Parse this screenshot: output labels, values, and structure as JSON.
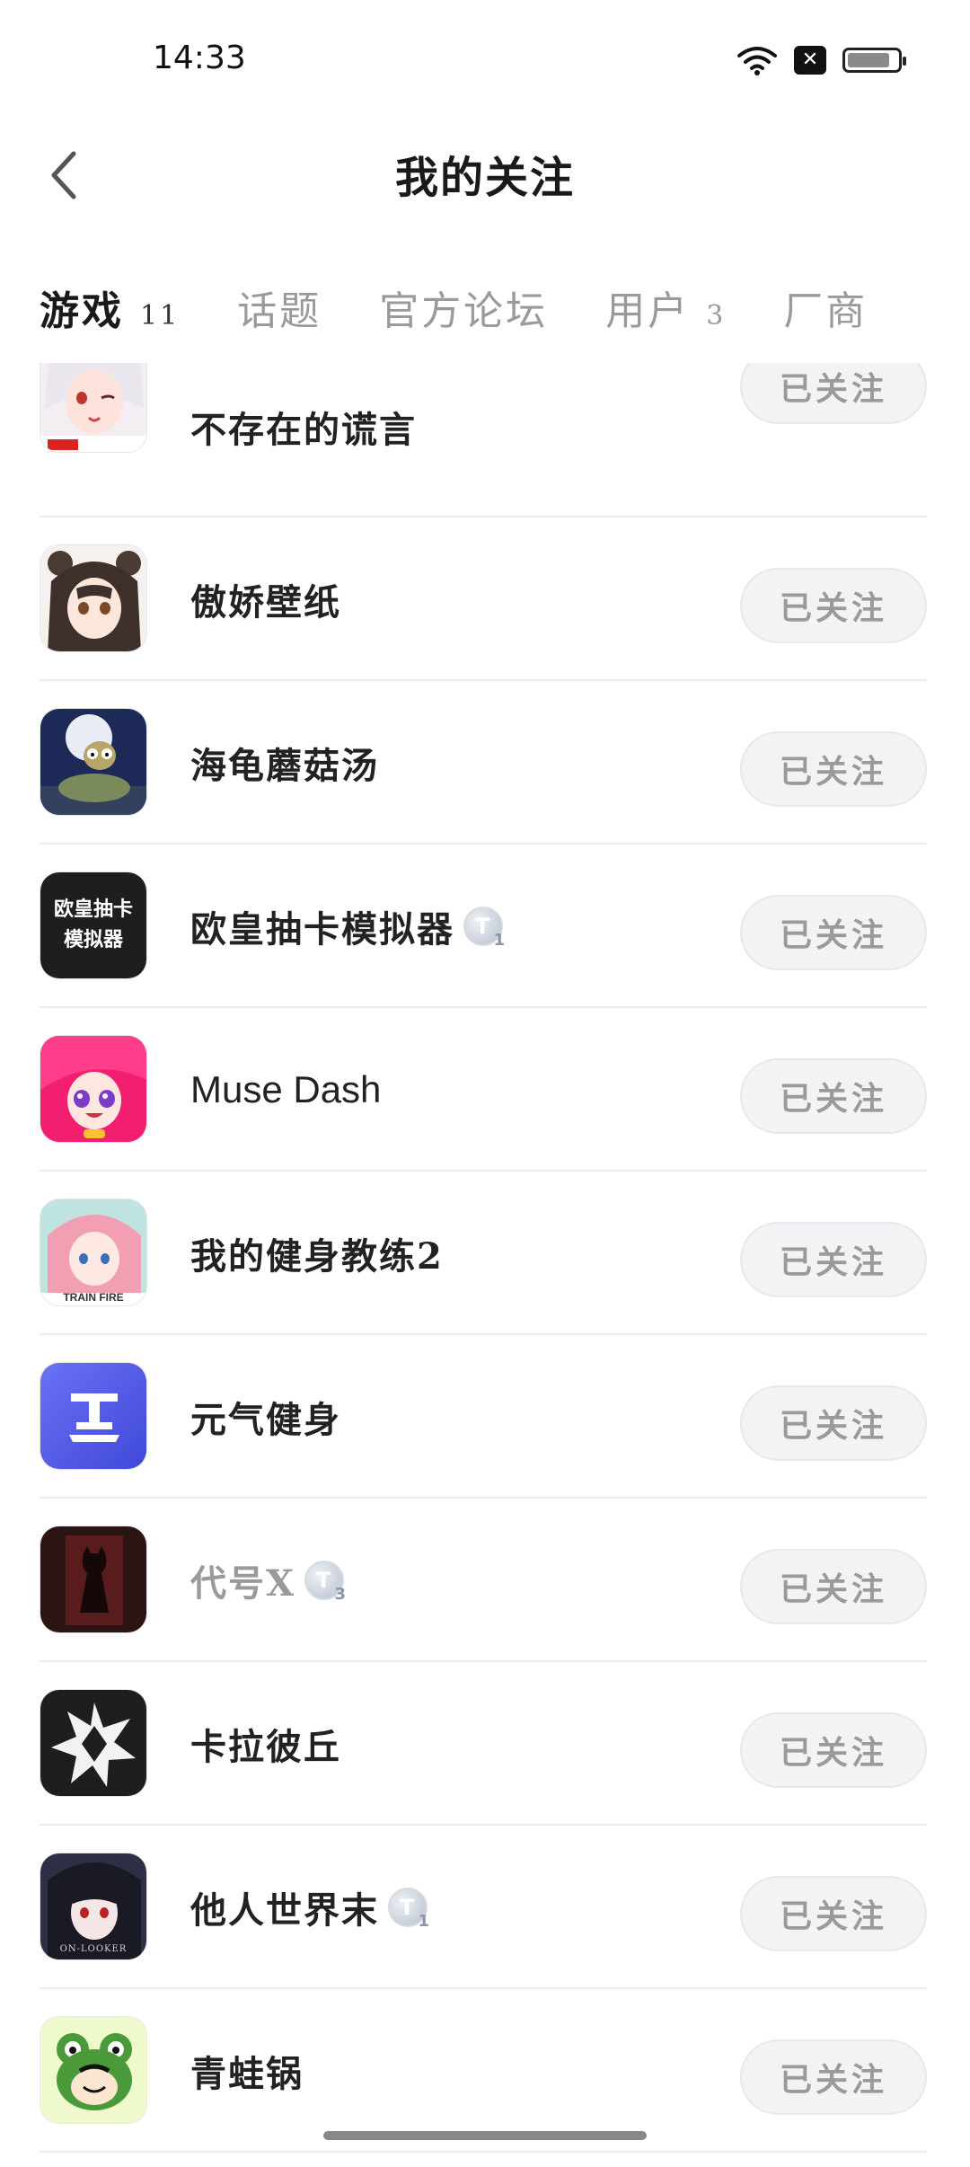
{
  "status_bar": {
    "time": "14:33",
    "icons": [
      "wifi-icon",
      "sim-icon",
      "battery-icon"
    ],
    "battery_level": 0.85
  },
  "header": {
    "title": "我的关注",
    "back_icon": "chevron-left-icon"
  },
  "tabs": [
    {
      "label": "游戏",
      "count": "11",
      "active": true
    },
    {
      "label": "话题",
      "count": "",
      "active": false
    },
    {
      "label": "官方论坛",
      "count": "",
      "active": false
    },
    {
      "label": "用户",
      "count": "3",
      "active": false
    },
    {
      "label": "厂商",
      "count": "",
      "active": false
    }
  ],
  "follow_label": "已关注",
  "items": [
    {
      "name": "不存在的谎言",
      "icon": "app-icon-anime-girl-white-hair",
      "badge": "",
      "badge_sub": ""
    },
    {
      "name": "傲娇壁纸",
      "icon": "app-icon-anime-girl-panda-hood",
      "badge": "",
      "badge_sub": ""
    },
    {
      "name": "海龟蘑菇汤",
      "icon": "app-icon-turtle-moon",
      "badge": "",
      "badge_sub": ""
    },
    {
      "name": "欧皇抽卡模拟器",
      "icon": "app-icon-text-black",
      "icon_text": [
        "欧皇抽卡",
        "模拟器"
      ],
      "badge": "T",
      "badge_sub": "1"
    },
    {
      "name": "Muse Dash",
      "icon": "app-icon-muse-dash-pink",
      "badge": "",
      "badge_sub": ""
    },
    {
      "name": "我的健身教练2",
      "icon": "app-icon-pink-hair-girl",
      "icon_caption": "TRAIN FIRE",
      "badge": "",
      "badge_sub": ""
    },
    {
      "name": "元气健身",
      "icon": "app-icon-blue-logo",
      "badge": "",
      "badge_sub": ""
    },
    {
      "name": "代号X",
      "icon": "app-icon-dark-silhouette",
      "badge": "T",
      "badge_sub": "3",
      "dim": true
    },
    {
      "name": "卡拉彼丘",
      "icon": "app-icon-black-star",
      "badge": "",
      "badge_sub": ""
    },
    {
      "name": "他人世界末",
      "icon": "app-icon-dark-hair-girl",
      "icon_caption": "ON-LOOKER",
      "badge": "T",
      "badge_sub": "1"
    },
    {
      "name": "青蛙锅",
      "icon": "app-icon-frog",
      "badge": "",
      "badge_sub": ""
    }
  ]
}
